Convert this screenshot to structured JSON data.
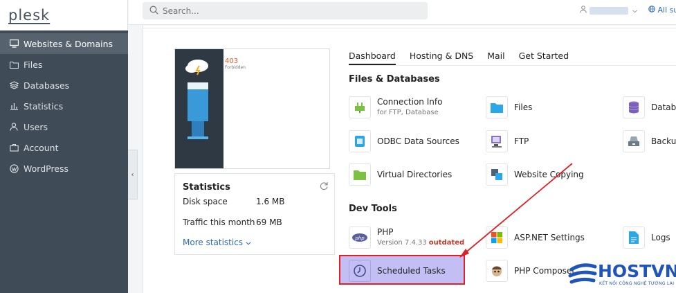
{
  "sidebar": {
    "logo": "plesk",
    "items": [
      {
        "label": "Websites & Domains",
        "icon": "monitor-icon",
        "active": true
      },
      {
        "label": "Files",
        "icon": "folder-icon"
      },
      {
        "label": "Databases",
        "icon": "layers-icon"
      },
      {
        "label": "Statistics",
        "icon": "bar-chart-icon"
      },
      {
        "label": "Users",
        "icon": "user-icon"
      },
      {
        "label": "Account",
        "icon": "briefcase-icon"
      },
      {
        "label": "WordPress",
        "icon": "wordpress-icon"
      }
    ],
    "collapse_glyph": "‹"
  },
  "topbar": {
    "search_placeholder": "Search...",
    "subscriptions_label": "All su"
  },
  "preview": {
    "code": "403",
    "text": "Forbidden"
  },
  "statistics": {
    "title": "Statistics",
    "rows": [
      {
        "label": "Disk space",
        "value": "1.6 MB"
      },
      {
        "label": "Traffic this month",
        "value": "69 MB"
      }
    ],
    "more_label": "More statistics"
  },
  "tabs": [
    {
      "label": "Dashboard",
      "active": true
    },
    {
      "label": "Hosting & DNS"
    },
    {
      "label": "Mail"
    },
    {
      "label": "Get Started"
    }
  ],
  "sections": {
    "files_databases": "Files & Databases",
    "dev_tools": "Dev Tools"
  },
  "tools": {
    "connection_info": {
      "label": "Connection Info",
      "sub": "for FTP, Database"
    },
    "files": {
      "label": "Files"
    },
    "databases": {
      "label": "Databa"
    },
    "odbc": {
      "label": "ODBC Data Sources"
    },
    "ftp": {
      "label": "FTP"
    },
    "backup": {
      "label": "Backup"
    },
    "virtual_dirs": {
      "label": "Virtual Directories"
    },
    "website_copying": {
      "label": "Website Copying"
    },
    "php": {
      "label": "PHP",
      "sub": "Version 7.4.33",
      "badge": "outdated"
    },
    "aspnet": {
      "label": "ASP.NET Settings"
    },
    "logs": {
      "label": "Logs"
    },
    "scheduled_tasks": {
      "label": "Scheduled Tasks"
    },
    "php_composer": {
      "label": "PHP Composer"
    }
  },
  "watermark": {
    "brand": "HOSTVN",
    "tagline": "KẾT NỐI CÔNG NGHỆ TƯƠNG LAI"
  },
  "colors": {
    "sidebar_bg": "#3f4b57",
    "link": "#2d6bb3",
    "highlight_fill": "#c3bff4",
    "highlight_border": "#e01f26",
    "outdated": "#c0392b"
  }
}
